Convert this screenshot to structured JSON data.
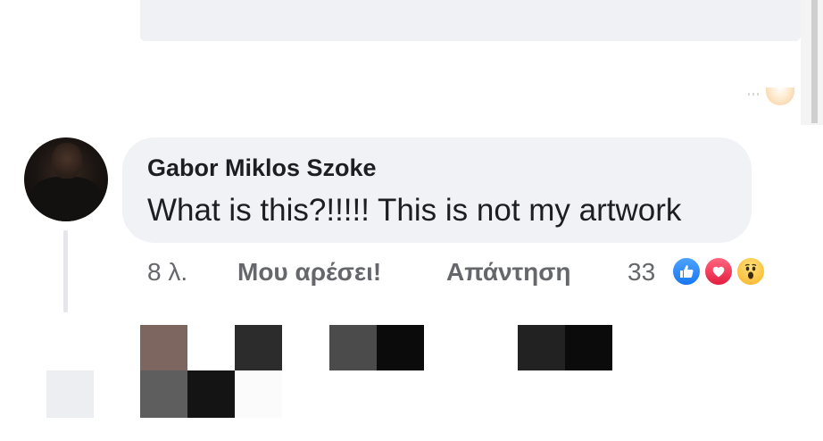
{
  "comment": {
    "author": "Gabor Miklos Szoke",
    "text": "What is this?!!!!! This is not my artwork",
    "time": "8 λ.",
    "like_label": "Μου αρέσει!",
    "reply_label": "Απάντηση",
    "reaction_count": "33",
    "reactions": [
      "like-icon",
      "love-icon",
      "wow-icon"
    ]
  },
  "colors": {
    "bubble": "#f0f2f5",
    "action_text": "#65676b",
    "author_text": "#1c1e21",
    "like_blue": "#1877f2",
    "love_red": "#e41e3f",
    "wow_yellow": "#f7b125"
  }
}
